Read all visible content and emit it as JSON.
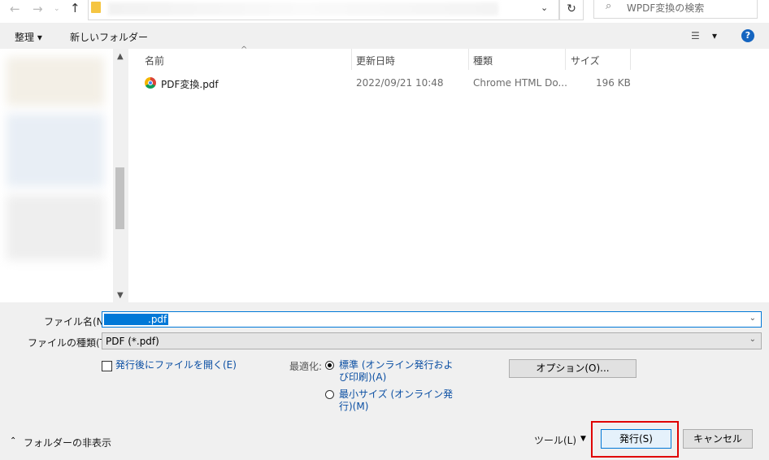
{
  "address_bar": {
    "search_placeholder": "WPDF変換の検索"
  },
  "toolbar": {
    "organize_label": "整理 ▾",
    "new_folder_label": "新しいフォルダー",
    "view_label": "▾"
  },
  "file_list": {
    "columns": [
      "名前",
      "更新日時",
      "種類",
      "サイズ"
    ],
    "rows": [
      {
        "name": "PDF変換.pdf",
        "modified": "2022/09/21 10:48",
        "type": "Chrome HTML Do...",
        "size": "196 KB"
      }
    ]
  },
  "form": {
    "filename_label": "ファイル名(N):",
    "filename_value": ".pdf",
    "filetype_label": "ファイルの種類(T):",
    "filetype_value": "PDF (*.pdf)",
    "open_after_label": "発行後にファイルを開く(E)",
    "optimize_label": "最適化:",
    "optimize_standard": "標準 (オンライン発行および印刷)(A)",
    "optimize_standard_line1": "標準 (オンライン発行およ",
    "optimize_standard_line2": "び印刷)(A)",
    "optimize_min_line1": "最小サイズ (オンライン発",
    "optimize_min_line2": "行)(M)",
    "options_button": "オプション(O)..."
  },
  "footer": {
    "hide_folders": "フォルダーの非表示",
    "tools": "ツール(L)",
    "publish": "発行(S)",
    "cancel": "キャンセル"
  }
}
